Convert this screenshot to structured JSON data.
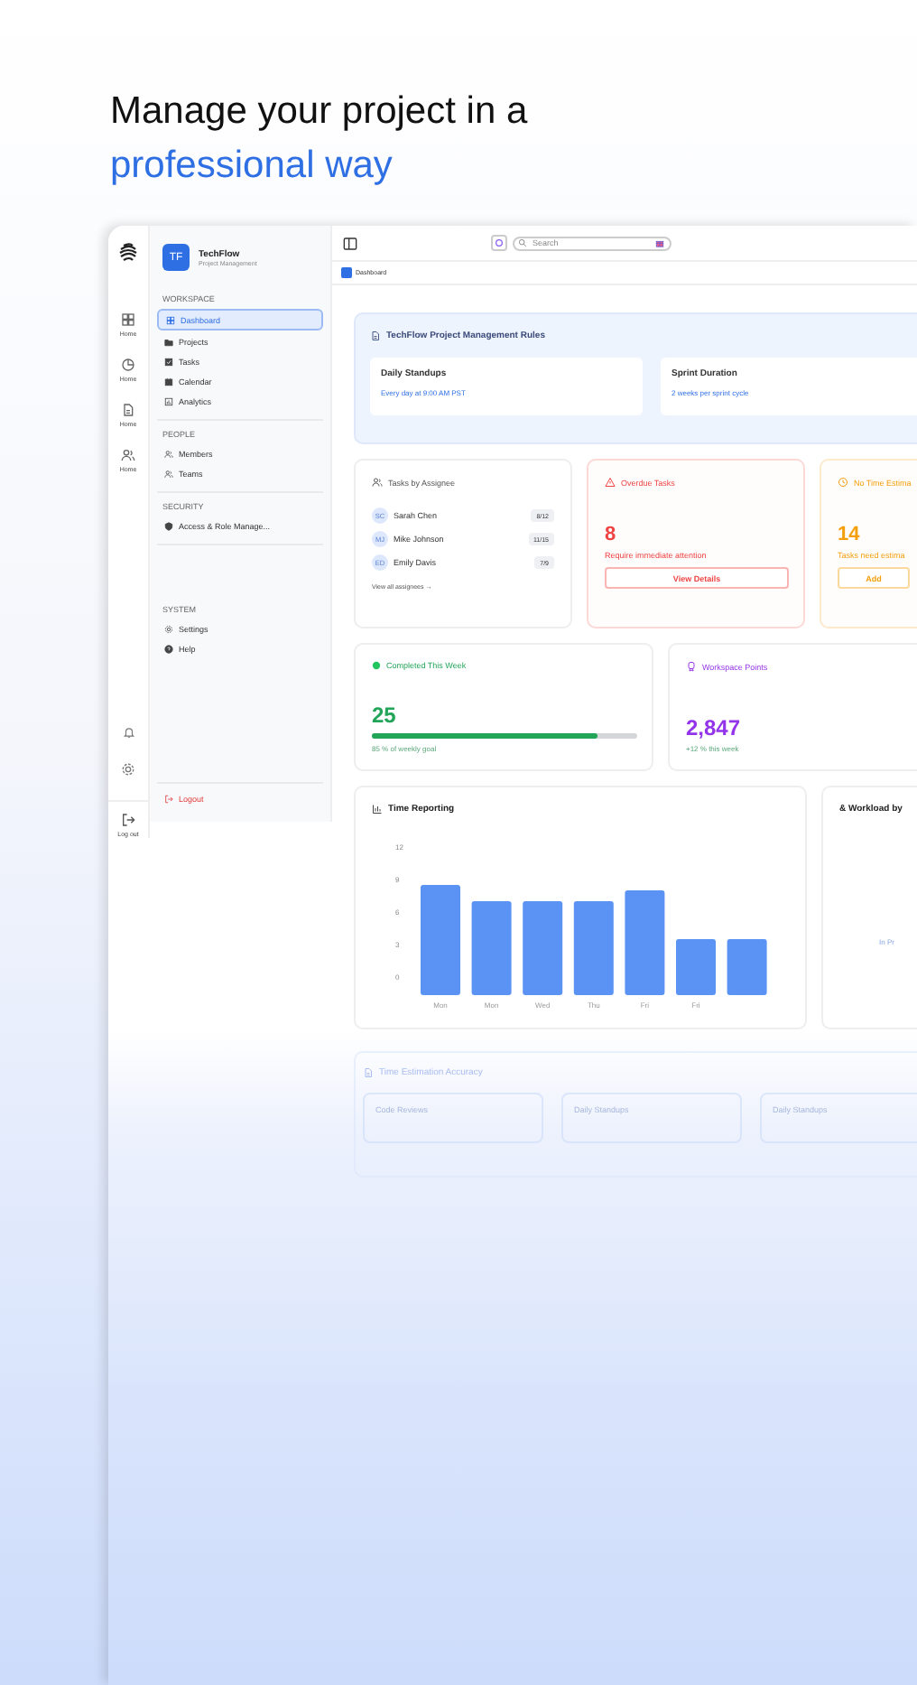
{
  "headline": {
    "line_1": "Manage your project in a",
    "line_2": "professional way"
  },
  "rail": {
    "items": [
      {
        "label": "Home"
      },
      {
        "label": "Home"
      },
      {
        "label": "Home"
      },
      {
        "label": "Home"
      }
    ],
    "logout": "Log out"
  },
  "sidebar": {
    "brand": {
      "initials": "TF",
      "name": "TechFlow",
      "subtitle": "Project Management"
    },
    "sections": [
      {
        "heading": "WORKSPACE",
        "items": [
          {
            "label": "Dashboard",
            "selected": true
          },
          {
            "label": "Projects",
            "selected": false
          },
          {
            "label": "Tasks",
            "selected": false
          },
          {
            "label": "Calendar",
            "selected": false
          },
          {
            "label": "Analytics",
            "selected": false
          }
        ]
      },
      {
        "heading": "PEOPLE",
        "items": [
          {
            "label": "Members",
            "selected": false
          },
          {
            "label": "Teams",
            "selected": false
          }
        ]
      },
      {
        "heading": "SECURITY",
        "items": [
          {
            "label": "Access & Role Manage...",
            "selected": false
          }
        ]
      },
      {
        "heading": "SYSTEM",
        "items": [
          {
            "label": "Settings",
            "selected": false
          },
          {
            "label": "Help",
            "selected": false
          }
        ]
      }
    ],
    "logout": "Logout"
  },
  "topbar": {
    "search": {
      "placeholder": "Search"
    }
  },
  "breadcrumb": "Dashboard",
  "rules": {
    "title": "TechFlow Project Management Rules",
    "items": [
      {
        "title": "Daily Standups",
        "detail": "Every day at 9:00 AM PST"
      },
      {
        "title": "Sprint Duration",
        "detail": "2 weeks per sprint cycle"
      }
    ]
  },
  "assignees": {
    "title": "Tasks by Assignee",
    "rows": [
      {
        "initials": "SC",
        "name": "Sarah Chen",
        "count": "8/12"
      },
      {
        "initials": "MJ",
        "name": "Mike Johnson",
        "count": "11/15"
      },
      {
        "initials": "ED",
        "name": "Emily Davis",
        "count": "7/9"
      }
    ],
    "link": "View all assignees →"
  },
  "alerts": [
    {
      "title": "Overdue Tasks",
      "value": "8",
      "note": "Require immediate attention",
      "button": "View Details",
      "color": "#ef4444"
    },
    {
      "title": "No Time Estima",
      "value": "14",
      "note": "Tasks need estima",
      "button": "Add",
      "color": "#f59e0b"
    }
  ],
  "metrics": [
    {
      "kind": "progress",
      "title": "Completed This Week",
      "value": "25",
      "level": 0.85,
      "note": "85 % of weekly goal"
    },
    {
      "kind": "points",
      "title": "Workspace Points",
      "value": "2,847",
      "note": "+12 % this week"
    }
  ],
  "time_reporting": {
    "title": "Time Reporting",
    "chart_data": {
      "type": "bar",
      "categories": [
        "Mon",
        "Mon",
        "Wed",
        "Thu",
        "Fri",
        "Fri",
        null
      ],
      "series": [
        {
          "color": "#5b93f5",
          "values": [
            8.5,
            7,
            7,
            7,
            8,
            3.5,
            3.5
          ]
        }
      ],
      "ylim": [
        0,
        12
      ],
      "yticks": [
        0,
        3,
        6,
        9,
        12
      ]
    }
  },
  "workload": {
    "title": "& Workload by",
    "label": "In Pr"
  },
  "accuracy": {
    "title": "Time Estimation Accuracy",
    "items": [
      "Code Reviews",
      "Daily Standups",
      "Daily Standups"
    ]
  }
}
